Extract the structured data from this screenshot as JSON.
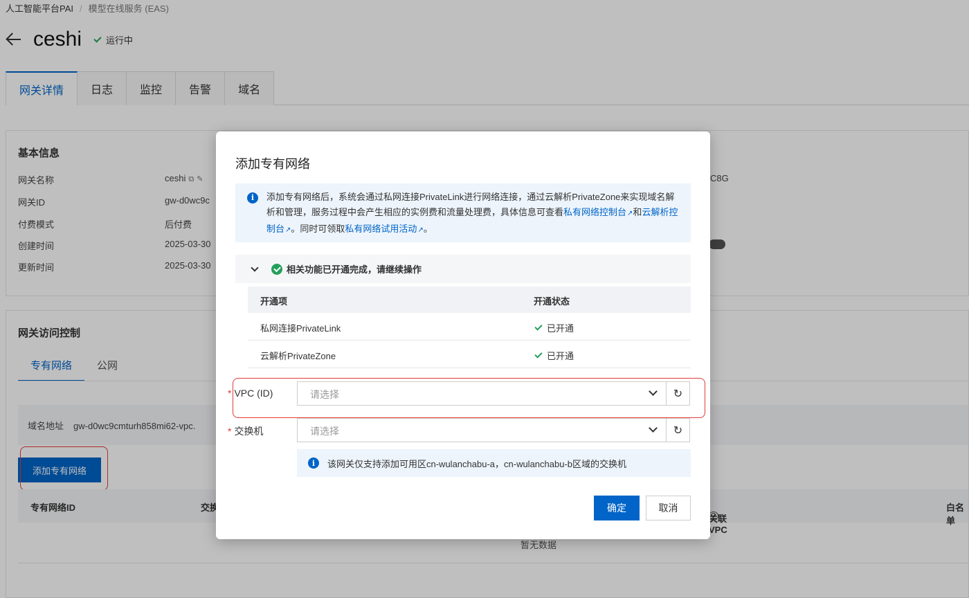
{
  "breadcrumb": {
    "root": "人工智能平台PAI",
    "current": "模型在线服务 (EAS)"
  },
  "header": {
    "title": "ceshi",
    "status": "运行中"
  },
  "tabs": [
    {
      "label": "网关详情",
      "active": true
    },
    {
      "label": "日志"
    },
    {
      "label": "监控"
    },
    {
      "label": "告警"
    },
    {
      "label": "域名"
    }
  ],
  "basic_info": {
    "title": "基本信息",
    "rows": [
      {
        "label": "网关名称",
        "value": "ceshi"
      },
      {
        "label": "网关ID",
        "value": "gw-d0wc9c"
      },
      {
        "label": "付费模式",
        "value": "后付费"
      },
      {
        "label": "创建时间",
        "value": "2025-03-30"
      },
      {
        "label": "更新时间",
        "value": "2025-03-30"
      }
    ],
    "right_fragment": "C8G"
  },
  "access_control": {
    "title": "网关访问控制",
    "subtabs": [
      {
        "label": "专有网络",
        "active": true
      },
      {
        "label": "公网"
      }
    ],
    "domain_label": "域名地址",
    "domain_value": "gw-d0wc9cmturh858mi62-vpc.",
    "add_button": "添加专有网络",
    "columns": {
      "vpc_id": "专有网络ID",
      "switch_partial": "交换",
      "assoc_vpc": "关联VPC",
      "whitelist_partial": "白名单"
    },
    "empty_text": "暂无数据"
  },
  "modal": {
    "title": "添加专有网络",
    "notice": {
      "text1": "添加专有网络后，系统会通过私网连接PrivateLink进行网络连接，通过云解析PrivateZone来实现域名解析和管理，服务过程中会产生相应的实例费和流量处理费，具体信息可查看",
      "link1": "私有网络控制台",
      "text2": "和",
      "link2": "云解析控制台",
      "text3": "。同时可领取",
      "link3": "私有网络试用活动",
      "text4": "。"
    },
    "accordion_title": "相关功能已开通完成，请继续操作",
    "feature_table": {
      "headers": {
        "item": "开通项",
        "status": "开通状态"
      },
      "rows": [
        {
          "item": "私网连接PrivateLink",
          "status": "已开通"
        },
        {
          "item": "云解析PrivateZone",
          "status": "已开通"
        }
      ]
    },
    "vpc": {
      "label": "VPC (ID)",
      "placeholder": "请选择"
    },
    "switch": {
      "label": "交换机",
      "placeholder": "请选择"
    },
    "hint": "该网关仅支持添加可用区cn-wulanchabu-a，cn-wulanchabu-b区域的交换机",
    "confirm_button": "确定",
    "cancel_button": "取消"
  },
  "colors": {
    "primary": "#0064c8",
    "success": "#23a05a",
    "annotation": "#e23a3a"
  }
}
